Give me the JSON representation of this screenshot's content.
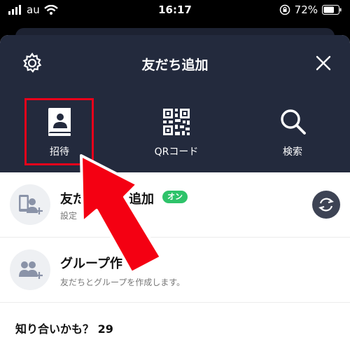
{
  "status_bar": {
    "carrier": "au",
    "time": "16:17",
    "battery": "72%"
  },
  "sheet": {
    "title": "友だち追加"
  },
  "actions": [
    {
      "label": "招待",
      "icon": "invite-contact-icon"
    },
    {
      "label": "QRコード",
      "icon": "qr-code-icon"
    },
    {
      "label": "検索",
      "icon": "search-icon"
    }
  ],
  "rows": {
    "auto_add": {
      "title_start": "友だ",
      "title_end": "追加",
      "badge": "オン",
      "sub_start": "設定"
    },
    "group": {
      "title": "グループ作",
      "sub": "友だちとグループを作成します。"
    }
  },
  "suggestions": {
    "title": "知り合いかも？ 29"
  },
  "colors": {
    "header": "#232a3d",
    "accent_green": "#2ec36a",
    "highlight_red": "#e8001a"
  }
}
